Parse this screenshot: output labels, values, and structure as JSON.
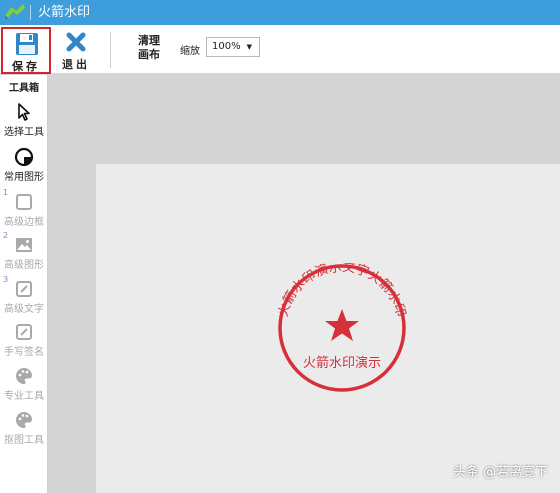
{
  "window": {
    "title": "火箭水印"
  },
  "toolbar": {
    "save_label": "保存",
    "exit_label": "退出",
    "clear_line1": "清理",
    "clear_line2": "画布",
    "zoom_label": "缩放",
    "zoom_value": "100%"
  },
  "sidebar": {
    "header": "工具箱",
    "tools": [
      {
        "label": "选择工具",
        "icon": "cursor-icon",
        "enabled": true
      },
      {
        "label": "常用图形",
        "icon": "circle-shape-icon",
        "enabled": true
      },
      {
        "number": "1",
        "label": "高级边框",
        "icon": "square-border-icon",
        "enabled": false
      },
      {
        "number": "2",
        "label": "高级图形",
        "icon": "image-icon",
        "enabled": false
      },
      {
        "number": "3",
        "label": "高级文字",
        "icon": "edit-icon",
        "enabled": false
      },
      {
        "label": "手写签名",
        "icon": "pen-icon",
        "enabled": false
      },
      {
        "label": "专业工具",
        "icon": "palette-icon",
        "enabled": false
      },
      {
        "label": "抠图工具",
        "icon": "palette-icon",
        "enabled": false
      }
    ]
  },
  "stamp": {
    "ring_text": "火箭水印演示文字火箭水印",
    "center_text": "火箭水印演示",
    "color": "#d6313b"
  },
  "watermark": "头条 @若离寛下",
  "colors": {
    "titlebar": "#3e9edb",
    "highlight": "#d6232b",
    "canvas_bg": "#d4d4d4"
  }
}
